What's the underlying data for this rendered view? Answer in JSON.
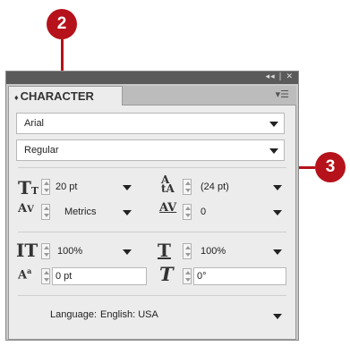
{
  "callouts": {
    "c2": "2",
    "c3": "3"
  },
  "window": {
    "controls": "◂◂ | ✕",
    "menu_icon": "panel-menu-icon"
  },
  "tab": {
    "diamond": "♦",
    "title": "CHARACTER"
  },
  "font_family": "Arial",
  "font_style": "Regular",
  "size": {
    "value": "20 pt"
  },
  "leading": {
    "value": "(24 pt)"
  },
  "kerning": {
    "value": "Metrics"
  },
  "tracking": {
    "value": "0"
  },
  "vscale": {
    "value": "100%"
  },
  "hscale": {
    "value": "100%"
  },
  "baseline": {
    "value": "0 pt"
  },
  "skew": {
    "value": "0°"
  },
  "language": {
    "label": "Language:",
    "value": "English: USA"
  },
  "colors": {
    "callout": "#b5121b",
    "panel_bg": "#ececec"
  }
}
